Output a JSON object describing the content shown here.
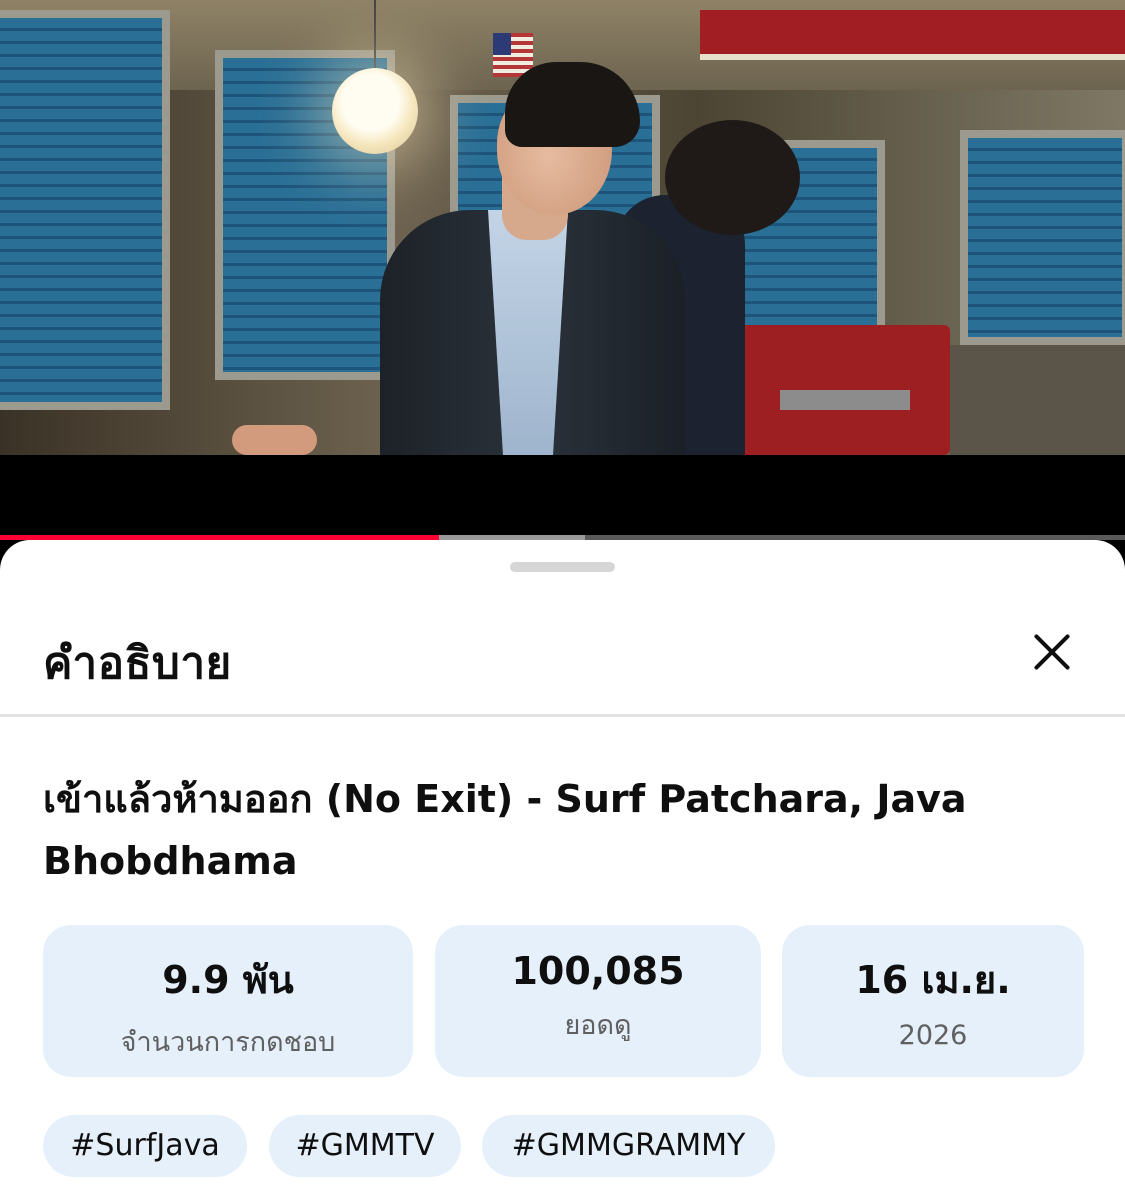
{
  "player": {
    "progress_played_fraction": 0.39,
    "progress_buffered_fraction": 0.52,
    "progress_color": "#ff0033"
  },
  "sheet": {
    "title": "คำอธิบาย",
    "close_icon": "close-icon"
  },
  "video": {
    "title": "เข้าแล้วห้ามออก (No Exit) - Surf Patchara, Java Bhobdhama"
  },
  "stats": [
    {
      "value": "9.9 พัน",
      "label": "จำนวนการกดชอบ"
    },
    {
      "value": "100,085",
      "label": "ยอดดู"
    },
    {
      "value": "16 เม.ย.",
      "label": "2026"
    }
  ],
  "hashtags": [
    "#SurfJava",
    "#GMMTV",
    "#GMMGRAMMY"
  ],
  "colors": {
    "chip_background": "#e5f0fa",
    "text_primary": "#0f0f0f",
    "text_secondary": "#606060"
  }
}
